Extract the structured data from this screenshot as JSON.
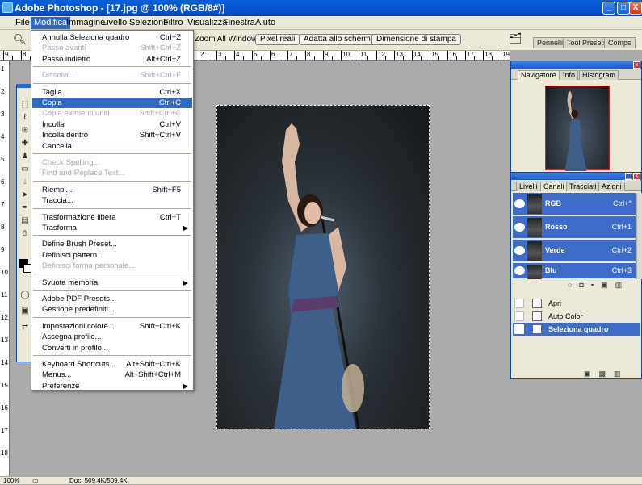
{
  "titlebar": {
    "title": "Adobe Photoshop - [17.jpg @ 100% (RGB/8#)]",
    "min": "_",
    "max": "□",
    "close": "X"
  },
  "menubar": {
    "items": [
      "File",
      "Modifica",
      "Immagine",
      "Livello",
      "Selezione",
      "Filtro",
      "Visualizza",
      "Finestra",
      "Aiuto"
    ],
    "active": "Modifica"
  },
  "options": {
    "zoom_all": "Zoom All Windows",
    "pixel_reali": "Pixel reali",
    "adatta": "Adatta allo schermo",
    "dimensione": "Dimensione di stampa",
    "tabs": [
      "Pennelli",
      "Tool Presets",
      "Comps"
    ]
  },
  "ruler": {
    "h": [
      "9",
      "8",
      "7",
      "6",
      "5",
      "4",
      "3",
      "2",
      "1",
      "0",
      "1",
      "2",
      "3",
      "4",
      "5",
      "6",
      "7",
      "8",
      "9",
      "10",
      "11",
      "12",
      "13",
      "14",
      "15",
      "16",
      "17",
      "18",
      "19"
    ],
    "v": [
      "1",
      "2",
      "3",
      "4",
      "5",
      "6",
      "7",
      "8",
      "9",
      "10",
      "11",
      "12",
      "13",
      "14",
      "15",
      "16",
      "17",
      "18"
    ]
  },
  "menu": {
    "items": [
      {
        "label": "Annulla Seleziona quadro",
        "shortcut": "Ctrl+Z",
        "disabled": false
      },
      {
        "label": "Passo avanti",
        "shortcut": "Shift+Ctrl+Z",
        "disabled": true
      },
      {
        "label": "Passo indietro",
        "shortcut": "Alt+Ctrl+Z",
        "disabled": false
      },
      {
        "label": "Dissolvi...",
        "shortcut": "Shift+Ctrl+F",
        "disabled": true
      },
      {
        "label": "Taglia",
        "shortcut": "Ctrl+X",
        "disabled": false
      },
      {
        "label": "Copia",
        "shortcut": "Ctrl+C",
        "disabled": false,
        "highlighted": true
      },
      {
        "label": "Copia elementi uniti",
        "shortcut": "Shift+Ctrl+C",
        "disabled": true
      },
      {
        "label": "Incolla",
        "shortcut": "Ctrl+V",
        "disabled": false
      },
      {
        "label": "Incolla dentro",
        "shortcut": "Shift+Ctrl+V",
        "disabled": false
      },
      {
        "label": "Cancella",
        "shortcut": "",
        "disabled": false
      },
      {
        "label": "Check Spelling...",
        "shortcut": "",
        "disabled": true
      },
      {
        "label": "Find and Replace Text...",
        "shortcut": "",
        "disabled": true
      },
      {
        "label": "Riempi...",
        "shortcut": "Shift+F5",
        "disabled": false
      },
      {
        "label": "Traccia...",
        "shortcut": "",
        "disabled": false
      },
      {
        "label": "Trasformazione libera",
        "shortcut": "Ctrl+T",
        "disabled": false
      },
      {
        "label": "Trasforma",
        "shortcut": "",
        "disabled": false,
        "submenu": true
      },
      {
        "label": "Define Brush Preset...",
        "shortcut": "",
        "disabled": false
      },
      {
        "label": "Definisci pattern...",
        "shortcut": "",
        "disabled": false
      },
      {
        "label": "Definisci forma personale...",
        "shortcut": "",
        "disabled": true
      },
      {
        "label": "Svuota memoria",
        "shortcut": "",
        "disabled": false,
        "submenu": true
      },
      {
        "label": "Adobe PDF Presets...",
        "shortcut": "",
        "disabled": false
      },
      {
        "label": "Gestione predefiniti...",
        "shortcut": "",
        "disabled": false
      },
      {
        "label": "Impostazioni colore...",
        "shortcut": "Shift+Ctrl+K",
        "disabled": false
      },
      {
        "label": "Assegna profilo...",
        "shortcut": "",
        "disabled": false
      },
      {
        "label": "Converti in profilo...",
        "shortcut": "",
        "disabled": false
      },
      {
        "label": "Keyboard Shortcuts...",
        "shortcut": "Alt+Shift+Ctrl+K",
        "disabled": false
      },
      {
        "label": "Menus...",
        "shortcut": "Alt+Shift+Ctrl+M",
        "disabled": false
      },
      {
        "label": "Preferenze",
        "shortcut": "",
        "disabled": false,
        "submenu": true
      }
    ]
  },
  "navigator": {
    "tabs": [
      "Navigatore",
      "Info",
      "Histogram"
    ]
  },
  "channels": {
    "tabs": [
      "Livelli",
      "Canali",
      "Tracciati",
      "Azioni"
    ],
    "rows": [
      {
        "name": "RGB",
        "shortcut": "Ctrl+°"
      },
      {
        "name": "Rosso",
        "shortcut": "Ctrl+1"
      },
      {
        "name": "Verde",
        "shortcut": "Ctrl+2"
      },
      {
        "name": "Blu",
        "shortcut": "Ctrl+3"
      }
    ]
  },
  "history": {
    "rows": [
      {
        "label": "Apri",
        "active": false
      },
      {
        "label": "Auto Color",
        "active": false
      },
      {
        "label": "Seleziona quadro",
        "active": true
      }
    ]
  },
  "status": {
    "zoom": "100%",
    "doc": "Doc: 509,4K/509,4K"
  },
  "colors": {
    "accent": "#316ac5",
    "titlebar": "#0554d4",
    "panel": "#ece9d8",
    "workspace": "#ababab"
  }
}
